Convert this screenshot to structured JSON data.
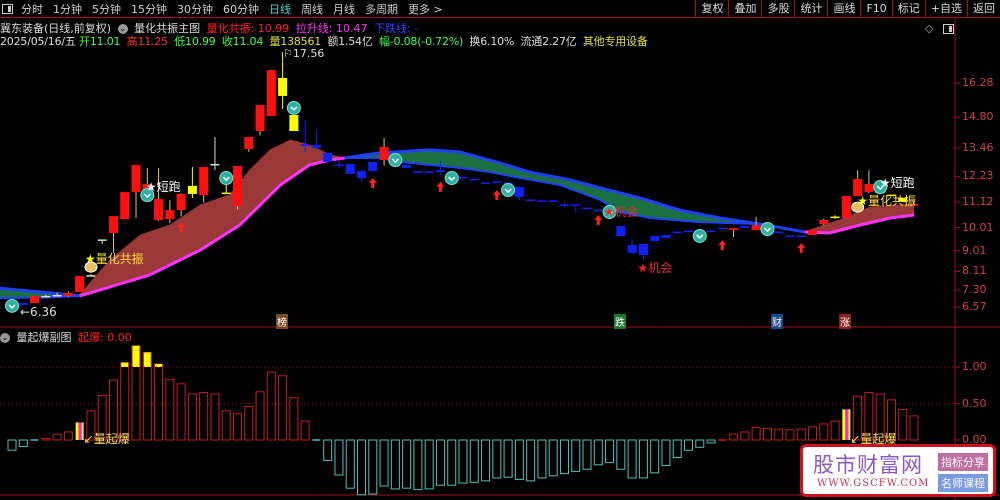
{
  "toolbar": {
    "tabs": [
      "分时",
      "1分钟",
      "5分钟",
      "15分钟",
      "30分钟",
      "60分钟",
      "日线",
      "周线",
      "月线",
      "多周期",
      "更多 >"
    ],
    "active": "日线",
    "right_buttons": [
      "复权",
      "叠加",
      "多股",
      "统计",
      "画线",
      "F10",
      "标记",
      "+自选",
      "返回"
    ]
  },
  "header": {
    "stock": "冀东装备(日线,前复权)",
    "indicator": "量化共振主图",
    "resonance": "量化共振: 10.99",
    "rise_line": "拉升线: 10.47",
    "fall_line": "下跌线: -"
  },
  "quote": {
    "date": "2025/05/16/五",
    "open_label": "开",
    "open": "11.01",
    "high_label": "高",
    "high": "11.25",
    "low_label": "低",
    "low": "10.99",
    "close_label": "收",
    "close": "11.04",
    "vol_label": "量",
    "vol": "138561",
    "amt": "额1.54亿",
    "chg_label": "幅",
    "chg": "-0.08(-0.72%)",
    "turnover": "换6.10%",
    "float": "流通2.27亿",
    "sector": "其他专用设备"
  },
  "price_axis": {
    "ticks": [
      "16.28",
      "14.80",
      "13.46",
      "12.23",
      "11.12",
      "10.01",
      "9.01",
      "8.11",
      "7.30",
      "6.57"
    ],
    "min": 6.57,
    "max": 16.28
  },
  "annotations": {
    "low": "←6.36",
    "high": "17.56",
    "events": [
      "榜",
      "跌",
      "财",
      "涨"
    ],
    "labels": [
      {
        "text": "量化共振",
        "i": 7,
        "p": 8.69,
        "color": "#ffe040",
        "star": "#ffff00"
      },
      {
        "text": "短跑",
        "i": 12.4,
        "p": 11.8,
        "color": "#ffffff",
        "star": "#ffffff"
      },
      {
        "text": "机会",
        "i": 53,
        "p": 10.75,
        "color": "#e03030",
        "star": "#ff2020"
      },
      {
        "text": "机会",
        "i": 56,
        "p": 8.3,
        "color": "#e03030",
        "star": "#ff2020"
      },
      {
        "text": "短跑",
        "i": 77.5,
        "p": 12.0,
        "color": "#ffffff",
        "star": "#ffffff"
      },
      {
        "text": "量化共振",
        "i": 75.5,
        "p": 11.2,
        "color": "#ffe040",
        "star": "#ffff00"
      }
    ]
  },
  "markers": {
    "teal": [
      [
        0,
        6.62
      ],
      [
        12,
        11.42
      ],
      [
        19,
        12.16
      ],
      [
        25,
        15.2
      ],
      [
        34,
        12.94
      ],
      [
        39,
        12.16
      ],
      [
        44,
        11.64
      ],
      [
        53,
        10.69
      ],
      [
        61,
        9.65
      ],
      [
        67,
        9.95
      ],
      [
        77,
        11.77
      ]
    ],
    "arrows": [
      [
        15,
        10.25
      ],
      [
        32,
        12.16
      ],
      [
        38,
        12.0
      ],
      [
        43,
        11.64
      ],
      [
        52,
        10.56
      ],
      [
        63,
        9.47
      ],
      [
        70,
        9.34
      ]
    ],
    "bags": [
      [
        7,
        8.3
      ],
      [
        75,
        10.9
      ]
    ]
  },
  "chart_data": [
    {
      "type": "candlestick",
      "title": "量化共振主图",
      "candles": [
        [
          "b",
          6.87,
          6.74
        ],
        [
          "b",
          6.74,
          6.66
        ],
        [
          "r",
          6.74,
          7.05
        ],
        [
          "x",
          7.05,
          7.05,
          7.1,
          7.0
        ],
        [
          "x",
          7.09,
          7.09,
          7.2,
          7.05
        ],
        [
          "r",
          7.05,
          7.18,
          7.25,
          7.0
        ],
        [
          "r",
          7.22,
          7.91
        ],
        [
          "x",
          7.95,
          7.95,
          8.0,
          7.9
        ],
        [
          "x",
          9.5,
          9.5,
          9.5,
          9.3
        ],
        [
          "r",
          9.78,
          10.51,
          10.51,
          8.91
        ],
        [
          "r",
          10.38,
          11.55
        ],
        [
          "r",
          11.55,
          12.73,
          12.73,
          10.43
        ],
        [
          "r",
          11.6,
          11.9,
          12.6,
          11.5
        ],
        [
          "r",
          10.34,
          11.25,
          12.6,
          10.3
        ],
        [
          "r",
          10.38,
          10.77,
          11.2,
          10.2
        ],
        [
          "r",
          10.77,
          11.47,
          11.5,
          10.5
        ],
        [
          "y",
          11.82,
          11.47,
          12.64,
          11.29
        ],
        [
          "r",
          11.42,
          12.64,
          12.64,
          11.1
        ],
        [
          "x",
          12.77,
          12.77,
          13.94,
          12.51
        ],
        [
          "y",
          11.53,
          11.49,
          12.1,
          11.49
        ],
        [
          "r",
          10.95,
          12.68,
          12.68,
          10.8
        ],
        [
          "r",
          13.42,
          13.94,
          13.94,
          13.3
        ],
        [
          "r",
          14.2,
          15.33,
          15.33,
          14.0
        ],
        [
          "r",
          14.85,
          16.84
        ],
        [
          "y",
          16.5,
          15.72,
          17.62,
          15.15
        ],
        [
          "y",
          14.89,
          14.2
        ],
        [
          "b",
          13.62,
          13.55,
          14.68,
          13.29
        ],
        [
          "b",
          13.59,
          13.46,
          14.24,
          13.4
        ],
        [
          "b",
          13.25,
          12.86
        ],
        [
          "b",
          12.76,
          12.7,
          12.9,
          12.6
        ],
        [
          "b",
          12.77,
          12.34
        ],
        [
          "b",
          12.47,
          12.16,
          12.5,
          12.0
        ],
        [
          "b",
          12.86,
          12.47
        ],
        [
          "r",
          12.94,
          13.51,
          13.9,
          12.7
        ],
        [
          "b",
          12.9,
          12.8
        ],
        [
          "b",
          12.73,
          12.6
        ],
        [
          "b",
          12.45,
          12.38
        ],
        [
          "b",
          12.45,
          12.38
        ],
        [
          "b",
          12.5,
          12.42,
          12.9,
          12.3
        ],
        [
          "b",
          12.3,
          12.25
        ],
        [
          "b",
          12.21,
          12.16
        ],
        [
          "b",
          12.12,
          12.08
        ],
        [
          "b",
          11.97,
          11.93
        ],
        [
          "b",
          12.02,
          11.97
        ],
        [
          "b",
          11.97,
          11.92
        ],
        [
          "b",
          11.77,
          11.34,
          11.8,
          11.2
        ],
        [
          "b",
          11.23,
          11.19
        ],
        [
          "b",
          11.19,
          11.15
        ],
        [
          "b",
          11.19,
          11.15
        ],
        [
          "b",
          11.02,
          10.97,
          11.1,
          10.9
        ],
        [
          "b",
          11.02,
          10.97,
          11.0,
          10.7
        ],
        [
          "b",
          10.88,
          10.84
        ],
        [
          "b",
          10.79,
          10.75
        ],
        [
          "b",
          10.72,
          10.68
        ],
        [
          "b",
          10.08,
          9.65
        ],
        [
          "b",
          9.26,
          8.91,
          9.5,
          8.9
        ],
        [
          "b",
          9.3,
          8.82,
          9.3,
          8.61
        ],
        [
          "b",
          9.65,
          9.43
        ],
        [
          "b",
          9.69,
          9.56
        ],
        [
          "b",
          9.84,
          9.8
        ],
        [
          "b",
          9.88,
          9.84
        ],
        [
          "b",
          9.88,
          9.84
        ],
        [
          "b",
          9.88,
          9.84
        ],
        [
          "b",
          10.01,
          9.97
        ],
        [
          "r",
          9.91,
          9.99,
          10.0,
          9.6
        ],
        [
          "b",
          10.08,
          9.99
        ],
        [
          "r",
          9.91,
          10.12,
          10.47,
          9.9
        ],
        [
          "b",
          9.97,
          9.93
        ],
        [
          "b",
          9.84,
          9.8
        ],
        [
          "b",
          9.67,
          9.63
        ],
        [
          "b",
          9.67,
          9.63
        ],
        [
          "r",
          9.69,
          9.91
        ],
        [
          "r",
          10.17,
          10.34,
          10.4,
          10.1
        ],
        [
          "y",
          10.49,
          10.45,
          10.55,
          10.4
        ],
        [
          "r",
          10.43,
          11.38
        ],
        [
          "r",
          11.38,
          12.12,
          12.5,
          11.38
        ],
        [
          "r",
          11.55,
          11.9,
          12.5,
          11.5
        ],
        [
          "y",
          11.62,
          11.5
        ],
        [
          "y",
          11.44,
          11.4
        ],
        [
          "y",
          11.29,
          11.12
        ],
        [
          "r",
          11.01,
          11.04,
          11.25,
          10.99
        ]
      ],
      "ribbons": [
        {
          "color": "#1a7040",
          "upper": [
            [
              -1.2,
              7.39
            ],
            [
              3,
              7.2
            ],
            [
              6,
              7.05
            ]
          ],
          "lower": [
            [
              -1.2,
              6.96
            ],
            [
              3,
              6.98
            ],
            [
              6,
              7.05
            ]
          ]
        },
        {
          "color": "#9a3838",
          "upper": [
            [
              6,
              7.09
            ],
            [
              8.7,
              8.61
            ],
            [
              11.4,
              9.69
            ],
            [
              14,
              10.12
            ],
            [
              16.7,
              10.99
            ],
            [
              19.3,
              11.42
            ],
            [
              21.1,
              12.51
            ],
            [
              22.9,
              13.38
            ],
            [
              24.7,
              13.81
            ],
            [
              26.4,
              13.59
            ],
            [
              28.2,
              13.16
            ],
            [
              29.5,
              13.03
            ]
          ],
          "lower": [
            [
              6,
              7.05
            ],
            [
              7.8,
              7.31
            ],
            [
              12.2,
              7.96
            ],
            [
              16.7,
              9.04
            ],
            [
              20.2,
              10.12
            ],
            [
              23.8,
              11.86
            ],
            [
              26.4,
              12.73
            ],
            [
              28.2,
              12.94
            ],
            [
              29.5,
              13.03
            ]
          ]
        },
        {
          "color": "#1a7040",
          "upper": [
            [
              29.5,
              13.03
            ],
            [
              32.6,
              13.25
            ],
            [
              37.1,
              13.38
            ],
            [
              39.7,
              13.29
            ],
            [
              43.3,
              12.81
            ],
            [
              45.9,
              12.42
            ],
            [
              49.5,
              12.08
            ],
            [
              52.2,
              11.73
            ],
            [
              55.7,
              11.3
            ],
            [
              59.2,
              10.77
            ],
            [
              62.8,
              10.43
            ],
            [
              66.3,
              10.17
            ]
          ],
          "lower": [
            [
              29.5,
              13.03
            ],
            [
              32.6,
              13.03
            ],
            [
              34.4,
              12.86
            ],
            [
              37.1,
              12.73
            ],
            [
              39.7,
              12.6
            ],
            [
              42.4,
              12.42
            ],
            [
              45.1,
              12.16
            ],
            [
              48.6,
              11.86
            ],
            [
              52.2,
              11.21
            ],
            [
              53.9,
              10.69
            ],
            [
              56.6,
              10.43
            ],
            [
              61,
              10.25
            ],
            [
              66.3,
              10.17
            ]
          ]
        },
        {
          "color": "#9a3838",
          "upper": [
            [
              70.3,
              9.82
            ],
            [
              73.4,
              10.34
            ],
            [
              76.1,
              10.9
            ],
            [
              80,
              11.04
            ]
          ],
          "lower": [
            [
              70.3,
              9.82
            ],
            [
              72.5,
              9.78
            ],
            [
              75.2,
              10.12
            ],
            [
              77.9,
              10.43
            ],
            [
              80,
              10.56
            ]
          ]
        }
      ],
      "blue_tail": [
        [
          66.3,
          10.17
        ],
        [
          70.3,
          9.82
        ]
      ],
      "colors": {
        "up": "#ff1010",
        "down": "#1020ff",
        "warn": "#ffff00",
        "rise_line": "#ff33ff",
        "fall_line": "#2040ff"
      }
    },
    {
      "type": "bar",
      "title": "量起爆副图",
      "value_label": "起爆: 0.00",
      "ylim": [
        -0.75,
        1.3
      ],
      "ticks": [
        "1.00",
        "0.50",
        "0.00"
      ],
      "tick_values": [
        1,
        0.5,
        0
      ],
      "values": [
        -0.14,
        -0.09,
        -0.01,
        0.02,
        0.08,
        0.11,
        0.24,
        0.4,
        0.61,
        0.82,
        1.06,
        1.29,
        1.2,
        1.04,
        0.83,
        0.77,
        0.63,
        0.65,
        0.63,
        0.4,
        0.36,
        0.46,
        0.66,
        0.93,
        0.88,
        0.58,
        0.26,
        -0.01,
        -0.28,
        -0.48,
        -0.66,
        -0.75,
        -0.74,
        -0.63,
        -0.67,
        -0.66,
        -0.68,
        -0.67,
        -0.62,
        -0.62,
        -0.59,
        -0.58,
        -0.56,
        -0.52,
        -0.51,
        -0.54,
        -0.56,
        -0.52,
        -0.49,
        -0.46,
        -0.43,
        -0.4,
        -0.34,
        -0.31,
        -0.4,
        -0.52,
        -0.52,
        -0.45,
        -0.35,
        -0.24,
        -0.14,
        -0.1,
        -0.04,
        0.0,
        0.08,
        0.11,
        0.17,
        0.16,
        0.15,
        0.14,
        0.15,
        0.18,
        0.22,
        0.26,
        0.42,
        0.6,
        0.65,
        0.63,
        0.55,
        0.42,
        0.33
      ],
      "signal_bars": [
        6,
        74
      ],
      "signal_label": "量起爆"
    }
  ],
  "watermark": {
    "name": "股市财富网",
    "url": "WWW.GSCFW.COM",
    "tag1": "指标分享",
    "tag2": "名师课程"
  }
}
